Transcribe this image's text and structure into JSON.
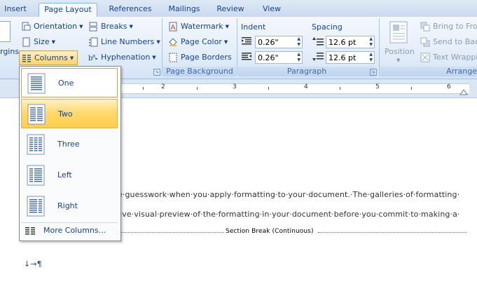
{
  "tabs": [
    "Insert",
    "Page Layout",
    "References",
    "Mailings",
    "Review",
    "View"
  ],
  "page_setup": {
    "orientation": "Orientation",
    "size": "Size",
    "columns": "Columns",
    "margins_partial": "rgins",
    "breaks": "Breaks",
    "line_numbers": "Line Numbers",
    "hyphenation": "Hyphenation"
  },
  "page_background": {
    "watermark": "Watermark",
    "page_color": "Page Color",
    "page_borders": "Page Borders",
    "label": "Page Background"
  },
  "paragraph": {
    "indent_label": "Indent",
    "spacing_label": "Spacing",
    "indent_left": "0.26\"",
    "indent_right": "0.26\"",
    "spacing_before": "12.6 pt",
    "spacing_after": "12.6 pt",
    "label": "Paragraph"
  },
  "arrange": {
    "position": "Position",
    "bring_to_front": "Bring to Fron",
    "send_to_back": "Send to Back",
    "text_wrapping": "Text Wrappin",
    "label": "Arrange"
  },
  "ruler": {
    "numbers": [
      "2",
      "3",
      "4",
      "5",
      "6"
    ]
  },
  "columns_menu": {
    "options": [
      {
        "label": "One",
        "icon": "one-column-icon"
      },
      {
        "label": "Two",
        "icon": "two-columns-icon"
      },
      {
        "label": "Three",
        "icon": "three-columns-icon"
      },
      {
        "label": "Left",
        "icon": "left-column-icon"
      },
      {
        "label": "Right",
        "icon": "right-column-icon"
      }
    ],
    "more": "More Columns..."
  },
  "document": {
    "line1": "e·guesswork·when·you·apply·formatting·to·your·document.·The·galleries·of·formatting·",
    "line2": "live·visual·preview·of·the·formatting·in·your·document·before·you·commit·to·making·a·",
    "section_break": "Section Break (Continuous)",
    "marks": "↓→¶"
  }
}
